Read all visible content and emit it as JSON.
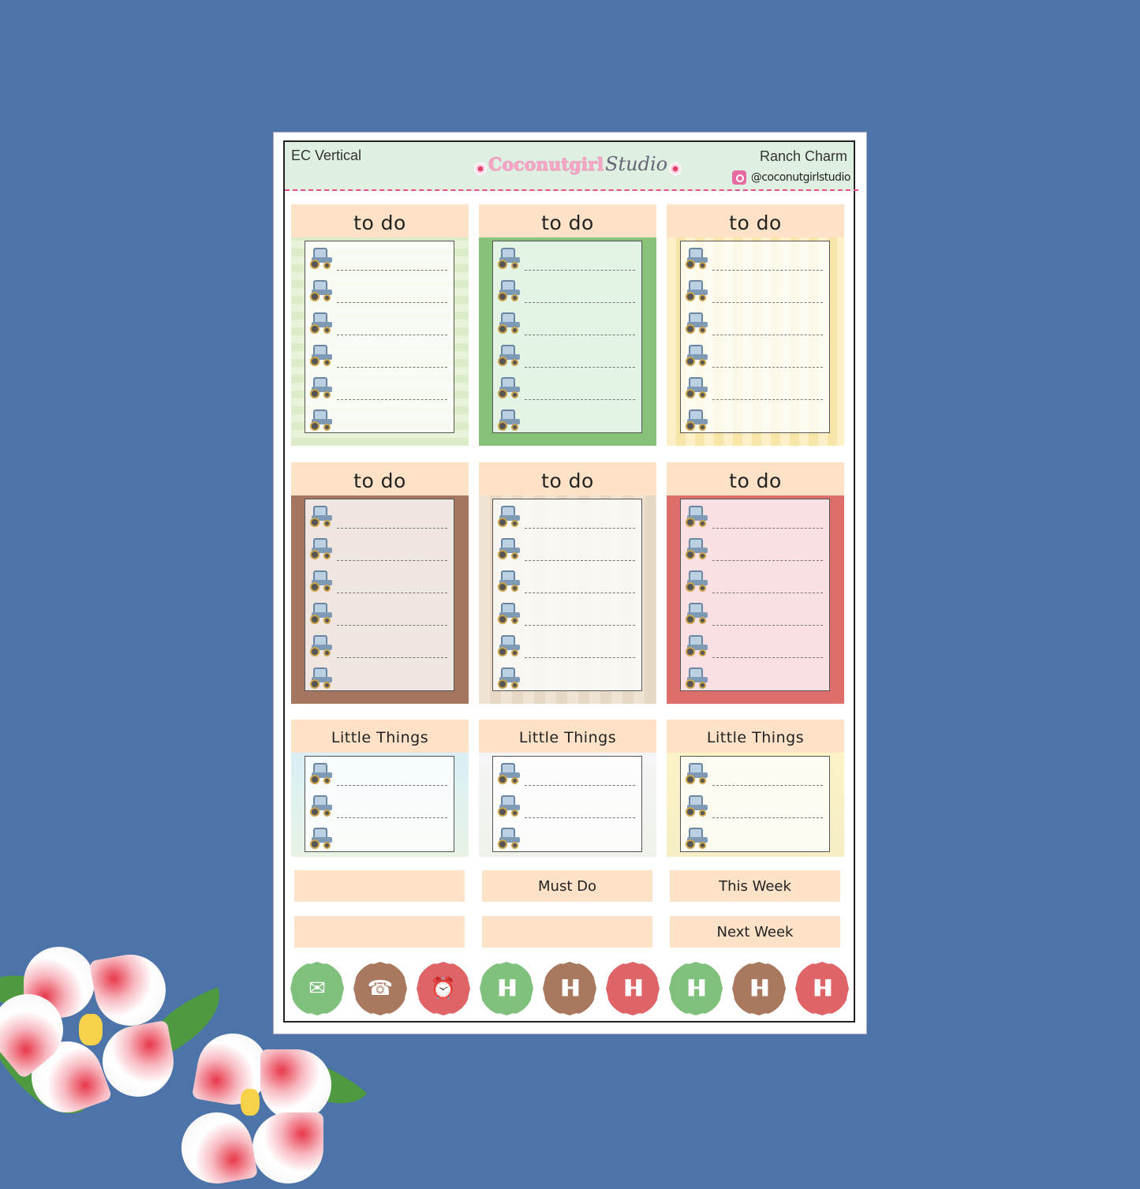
{
  "header": {
    "left_title": "EC Vertical",
    "right_title": "Ranch Charm",
    "handle": "@coconutgirlstudio",
    "logo_part1": "Coconutgirl",
    "logo_part2": "Studio"
  },
  "todo_cards": [
    {
      "title": "to do",
      "style": "green-pattern"
    },
    {
      "title": "to do",
      "style": "green"
    },
    {
      "title": "to do",
      "style": "yellow-pattern"
    },
    {
      "title": "to do",
      "style": "brown"
    },
    {
      "title": "to do",
      "style": "barn-pattern"
    },
    {
      "title": "to do",
      "style": "red"
    }
  ],
  "little_cards": [
    {
      "title": "Little Things"
    },
    {
      "title": "Little Things"
    },
    {
      "title": "Little Things"
    }
  ],
  "labels": {
    "r1c1": "",
    "r1c2": "Must Do",
    "r1c3": "This Week",
    "r2c1": "",
    "r2c2": "",
    "r2c3": "Next Week"
  },
  "icons": [
    {
      "name": "mail-icon",
      "color": "#7ec07c"
    },
    {
      "name": "phone-icon",
      "color": "#a8785f"
    },
    {
      "name": "alarm-clock-icon",
      "color": "#df6467"
    },
    {
      "name": "dumbbell-icon",
      "color": "#7ec07c"
    },
    {
      "name": "dumbbell-icon",
      "color": "#a8785f"
    },
    {
      "name": "dumbbell-icon",
      "color": "#df6467"
    },
    {
      "name": "dumbbell-icon",
      "color": "#7ec07c"
    },
    {
      "name": "dumbbell-icon",
      "color": "#a8785f"
    },
    {
      "name": "dumbbell-icon",
      "color": "#df6467"
    }
  ],
  "colors": {
    "background": "#4c74a8",
    "header_mint": "#dff0e2",
    "title_peach": "#fde2c8",
    "accent_pink": "#e84c8a"
  }
}
